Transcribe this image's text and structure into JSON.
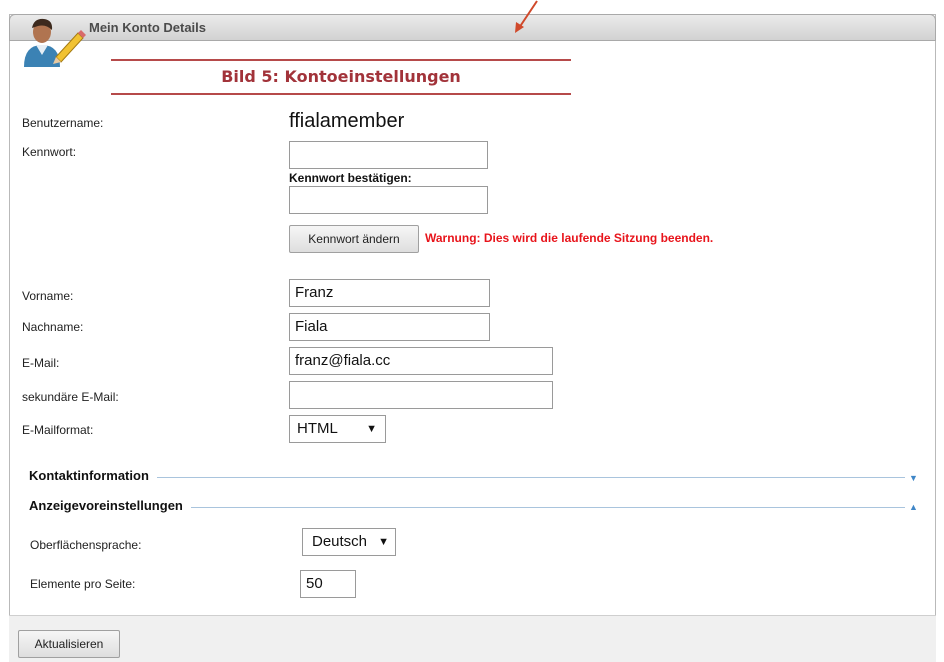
{
  "header": {
    "title": "Mein Konto Details"
  },
  "caption": "Bild 5: Kontoeinstellungen",
  "account": {
    "username_label": "Benutzername:",
    "username_value": "ffialamember",
    "password_label": "Kennwort:",
    "password_value": "",
    "confirm_label": "Kennwort bestätigen:",
    "confirm_value": "",
    "change_button": "Kennwort ändern",
    "warning": "Warnung: Dies wird die laufende Sitzung beenden."
  },
  "profile": {
    "firstname_label": "Vorname:",
    "firstname_value": "Franz",
    "lastname_label": "Nachname:",
    "lastname_value": "Fiala",
    "email_label": "E-Mail:",
    "email_value": "franz@fiala.cc",
    "email2_label": "sekundäre E-Mail:",
    "email2_value": "",
    "format_label": "E-Mailformat:",
    "format_value": "HTML"
  },
  "sections": {
    "contact": "Kontaktinformation",
    "display": "Anzeigevoreinstellungen"
  },
  "display": {
    "language_label": "Oberflächensprache:",
    "language_value": "Deutsch",
    "items_label": "Elemente pro Seite:",
    "items_value": "50"
  },
  "footer": {
    "update_button": "Aktualisieren"
  },
  "colors": {
    "warning": "#e8141b",
    "caption": "#a2333a",
    "section_line": "#a9c4dd",
    "arrow": "#3f86c7"
  }
}
